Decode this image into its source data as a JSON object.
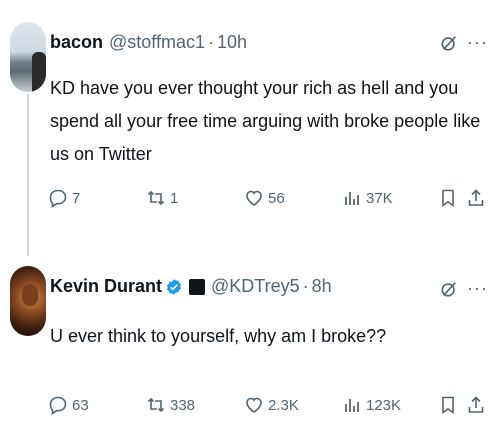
{
  "tweets": [
    {
      "name": "bacon",
      "handle": "@stoffmac1",
      "sep": "·",
      "time": "10h",
      "text": "KD have you ever thought your rich as hell and you spend all your free time arguing with broke people like us on Twitter",
      "stats": {
        "replies": "7",
        "reposts": "1",
        "likes": "56",
        "views": "37K"
      },
      "more": "···"
    },
    {
      "name": "Kevin Durant",
      "handle": "@KDTrey5",
      "sep": "·",
      "time": "8h",
      "verified": true,
      "text": "U ever think to yourself, why am I broke??",
      "stats": {
        "replies": "63",
        "reposts": "338",
        "likes": "2.3K",
        "views": "123K"
      },
      "more": "···"
    }
  ],
  "colors": {
    "muted": "#536471",
    "text": "#0f1419",
    "verified": "#1d9bf0",
    "thread": "#cfd9de"
  },
  "icons": [
    "grok-icon",
    "more-icon",
    "reply-icon",
    "repost-icon",
    "like-icon",
    "views-icon",
    "bookmark-icon",
    "share-icon",
    "verified-icon"
  ]
}
